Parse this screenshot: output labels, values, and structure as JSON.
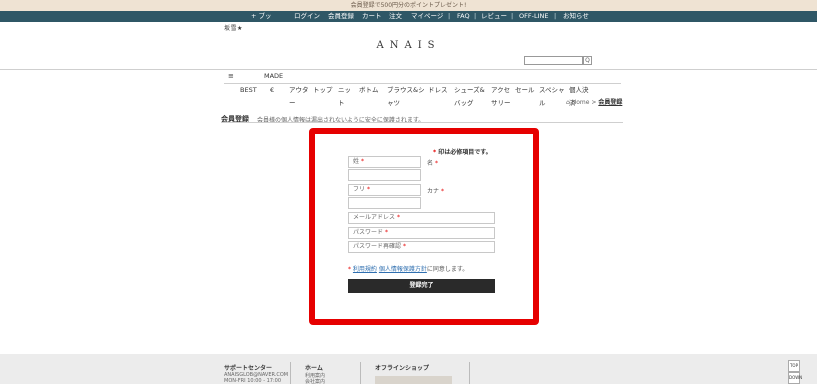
{
  "promo": "会員登録で500円分のポイントプレゼント!",
  "topnav": {
    "bookmark": "+ ブッ",
    "links": [
      "ログイン",
      "会員登録",
      "カート",
      "注文",
      "マイページ",
      "FAQ",
      "レビュー",
      "OFF-LINE",
      "お知らせ"
    ]
  },
  "small_logo": "坂雪★",
  "logo": "ANAIS",
  "search": {
    "button": "Q"
  },
  "menu": {
    "toggle": "≡",
    "made": "MADE"
  },
  "categories": [
    {
      "l1": "BEST",
      "l2": ""
    },
    {
      "l1": "€",
      "l2": ""
    },
    {
      "l1": "アウタ",
      "l2": "ー"
    },
    {
      "l1": "トップ",
      "l2": ""
    },
    {
      "l1": "ニッ",
      "l2": "ト"
    },
    {
      "l1": "ボトム",
      "l2": ""
    },
    {
      "l1": "ブラウス&シ",
      "l2": "ャツ"
    },
    {
      "l1": "ドレス",
      "l2": ""
    },
    {
      "l1": "シューズ&",
      "l2": "バッグ"
    },
    {
      "l1": "アクセ",
      "l2": "サリー"
    },
    {
      "l1": "セール",
      "l2": ""
    },
    {
      "l1": "スペシャ",
      "l2": "ル"
    },
    {
      "l1": "個人決",
      "l2": "済"
    }
  ],
  "breadcrumb": {
    "home": "Home",
    "sep": ">",
    "current": "会員登録"
  },
  "page": {
    "title": "会員登録",
    "subtitle": "会員様の個人情報は漏出されないように安全に保護されます。"
  },
  "form": {
    "required_note": "印は必修項目です。",
    "last_name": "姓",
    "first_name": "名",
    "last_kana": "フリ",
    "first_kana": "カナ",
    "email": "メールアドレス",
    "password": "パスワード",
    "password_confirm": "パスワード再確認",
    "terms_link": "利用規約",
    "privacy_link": "個人情報保護方針",
    "agree_text": "に同意します。",
    "submit": "登録完了"
  },
  "footer": {
    "support_title": "サポートセンター",
    "support_email": "ANAISGLOB@NAVER.COM",
    "support_hours": "MON-FRI 10:00 - 17:00",
    "home_title": "ホーム",
    "home_line1": "利用案内",
    "home_line2": "会社案内",
    "shop_title": "オフラインショップ"
  },
  "side": {
    "top": "TOP",
    "down": "DOWN"
  }
}
